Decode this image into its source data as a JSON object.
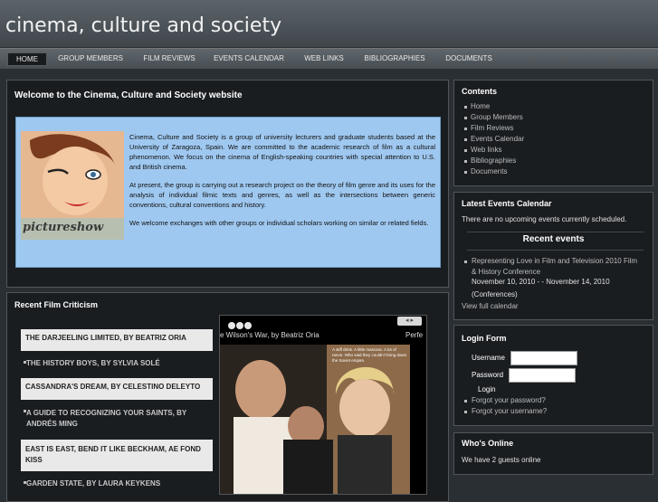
{
  "site": {
    "title": "cinema, culture and society"
  },
  "nav": [
    "HOME",
    "GROUP MEMBERS",
    "FILM REVIEWS",
    "EVENTS CALENDAR",
    "WEB LINKS",
    "BIBLIOGRAPHIES",
    "DOCUMENTS"
  ],
  "welcome": {
    "title": "Welcome to the Cinema, Culture and Society website",
    "image_label": "pictureshow",
    "paragraphs": [
      "Cinema, Culture and Society is a group of university lecturers and graduate students based at the University of Zaragoza, Spain. We are committed to the academic research of film as a cultural phenomenon. We focus on the cinema of English-speaking countries with special attention to U.S. and British cinema.",
      "At present, the group is carrying out a research project on the theory of film genre and its uses for the analysis of individual filmic texts and genres, as well as the intersections between generic conventions, cultural conventions and history.",
      "We welcome exchanges with other groups or individual scholars working on similar or related fields."
    ]
  },
  "recent_film": {
    "title": "Recent Film Criticism",
    "items": [
      "THE DARJEELING LIMITED, BY BEATRIZ ORIA",
      "THE HISTORY BOYS, BY SYLVIA SOLÉ",
      "CASSANDRA'S DREAM, BY CELESTINO DELEYTO",
      "A GUIDE TO RECOGNIZING YOUR SAINTS, BY ANDRÉS MING",
      "EAST IS EAST, BEND IT LIKE BECKHAM, AE FOND KISS",
      "GARDEN STATE, BY LAURA KEYKENS"
    ],
    "slide_caption": "e Wilson's War, by Beatriz Oria",
    "slide_next": "Perfe",
    "poster_tagline": "A stiff drink. A little mascara. A lot of nerve. Who said they couldn't bring down the Soviet empire."
  },
  "contents": {
    "title": "Contents",
    "items": [
      "Home",
      "Group Members",
      "Film Reviews",
      "Events Calendar",
      "Web links",
      "Bibliographies",
      "Documents"
    ]
  },
  "events": {
    "title": "Latest Events Calendar",
    "empty": "There are no upcoming events currently scheduled.",
    "recent_title": "Recent events",
    "event_title": "Representing Love in Film and Television 2010 Film & History Conference",
    "event_dates": "November 10, 2010 - - November 14, 2010",
    "event_type": "(Conferences)",
    "view_full": "View full calendar"
  },
  "login": {
    "title": "Login Form",
    "username_label": "Username",
    "password_label": "Password",
    "login_button": "Login",
    "forgot_password": "Forgot your password?",
    "forgot_username": "Forgot your username?"
  },
  "online": {
    "title": "Who's Online",
    "text": "We have 2 guests online"
  }
}
